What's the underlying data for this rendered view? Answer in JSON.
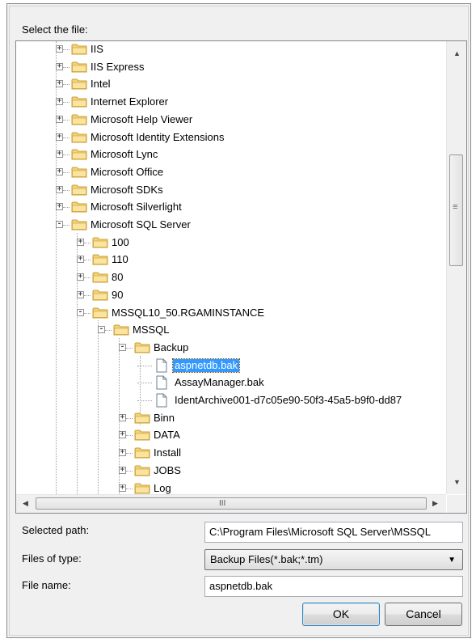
{
  "dialog": {
    "select_label": "Select the file:",
    "selected_path_label": "Selected path:",
    "selected_path_value": "C:\\Program Files\\Microsoft SQL Server\\MSSQL",
    "files_type_label": "Files of type:",
    "files_type_value": "Backup Files(*.bak;*.tm)",
    "file_name_label": "File name:",
    "file_name_value": "aspnetdb.bak",
    "ok_label": "OK",
    "cancel_label": "Cancel",
    "hscroll_grip": "III",
    "vscroll_grip": "≡"
  },
  "tree": [
    {
      "label": "IIS",
      "level": 0,
      "type": "folder",
      "expander": "+"
    },
    {
      "label": "IIS Express",
      "level": 0,
      "type": "folder",
      "expander": "+"
    },
    {
      "label": "Intel",
      "level": 0,
      "type": "folder",
      "expander": "+"
    },
    {
      "label": "Internet Explorer",
      "level": 0,
      "type": "folder",
      "expander": "+"
    },
    {
      "label": "Microsoft Help Viewer",
      "level": 0,
      "type": "folder",
      "expander": "+"
    },
    {
      "label": "Microsoft Identity Extensions",
      "level": 0,
      "type": "folder",
      "expander": "+"
    },
    {
      "label": "Microsoft Lync",
      "level": 0,
      "type": "folder",
      "expander": "+"
    },
    {
      "label": "Microsoft Office",
      "level": 0,
      "type": "folder",
      "expander": "+"
    },
    {
      "label": "Microsoft SDKs",
      "level": 0,
      "type": "folder",
      "expander": "+"
    },
    {
      "label": "Microsoft Silverlight",
      "level": 0,
      "type": "folder",
      "expander": "+"
    },
    {
      "label": "Microsoft SQL Server",
      "level": 0,
      "type": "folder",
      "expander": "-"
    },
    {
      "label": "100",
      "level": 1,
      "type": "folder",
      "expander": "+"
    },
    {
      "label": "110",
      "level": 1,
      "type": "folder",
      "expander": "+"
    },
    {
      "label": "80",
      "level": 1,
      "type": "folder",
      "expander": "+"
    },
    {
      "label": "90",
      "level": 1,
      "type": "folder",
      "expander": "+"
    },
    {
      "label": "MSSQL10_50.RGAMINSTANCE",
      "level": 1,
      "type": "folder",
      "expander": "-"
    },
    {
      "label": "MSSQL",
      "level": 2,
      "type": "folder",
      "expander": "-"
    },
    {
      "label": "Backup",
      "level": 3,
      "type": "folder",
      "expander": "-"
    },
    {
      "label": "aspnetdb.bak",
      "level": 4,
      "type": "file",
      "selected": true
    },
    {
      "label": "AssayManager.bak",
      "level": 4,
      "type": "file"
    },
    {
      "label": "IdentArchive001-d7c05e90-50f3-45a5-b9f0-dd87",
      "level": 4,
      "type": "file"
    },
    {
      "label": "Binn",
      "level": 3,
      "type": "folder",
      "expander": "+"
    },
    {
      "label": "DATA",
      "level": 3,
      "type": "folder",
      "expander": "+"
    },
    {
      "label": "Install",
      "level": 3,
      "type": "folder",
      "expander": "+"
    },
    {
      "label": "JOBS",
      "level": 3,
      "type": "folder",
      "expander": "+"
    },
    {
      "label": "Log",
      "level": 3,
      "type": "folder",
      "expander": "+"
    }
  ],
  "colors": {
    "selection": "#3399ff",
    "folder": "#f3d27a",
    "folder_edge": "#c9a036"
  }
}
